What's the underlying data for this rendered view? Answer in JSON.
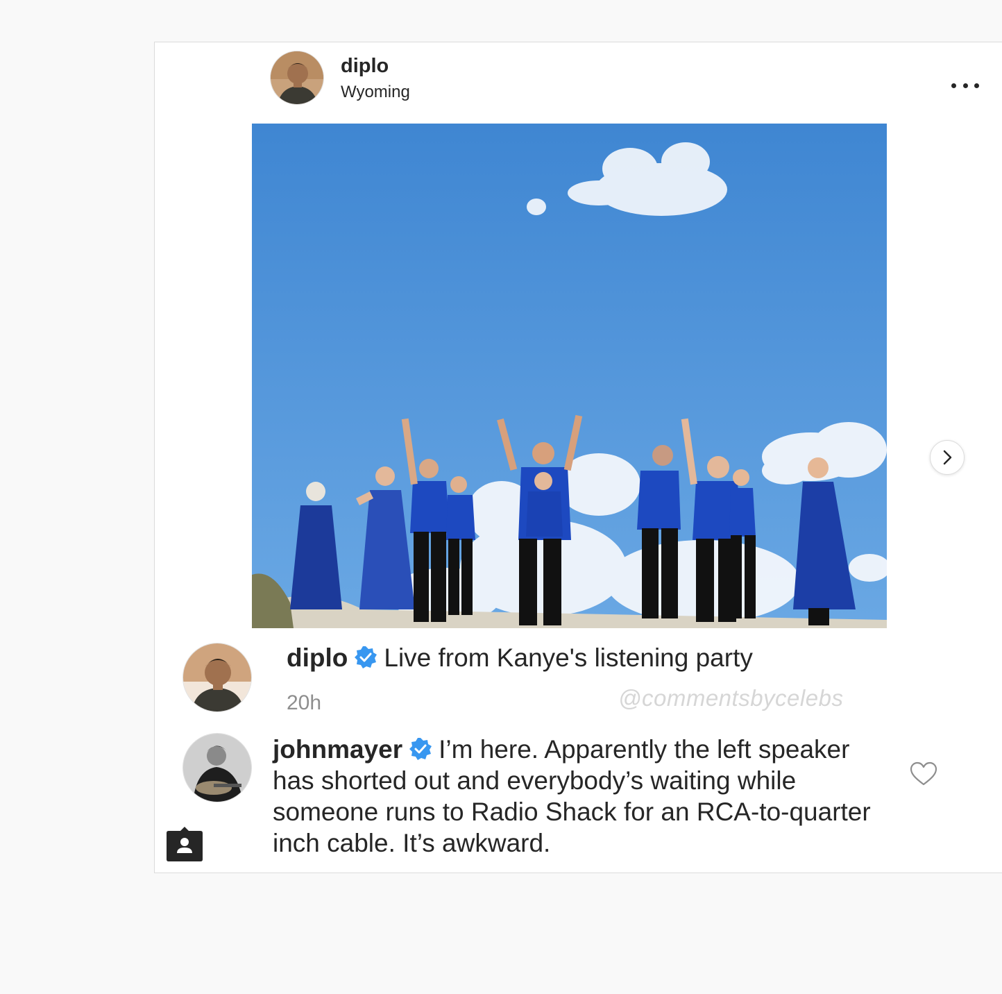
{
  "post": {
    "header": {
      "username": "diplo",
      "location": "Wyoming",
      "avatar_icon": "person-avatar-icon",
      "more_icon": "more-options-icon"
    },
    "image": {
      "description_icon": "group-photo-blue-sky",
      "sky_color": "#4b8fd6"
    },
    "carousel_next_icon": "chevron-right-icon",
    "caption": {
      "username": "diplo",
      "verified_icon": "verified-badge-icon",
      "text": "Live from Kanye's listening party",
      "timestamp": "20h",
      "watermark": "@commentsbycelebs"
    },
    "comment": {
      "username": "johnmayer",
      "verified_icon": "verified-badge-icon",
      "text": "I’m here. Apparently the left speaker has shorted out and everybody’s waiting while someone runs to Radio Shack for an RCA-to-quarter inch cable. It’s awkward.",
      "like_icon": "heart-outline-icon"
    },
    "profile_badge_icon": "profile-tag-icon"
  },
  "colors": {
    "verified": "#3897f0",
    "text": "#262626",
    "secondary": "#8e8e8e"
  }
}
